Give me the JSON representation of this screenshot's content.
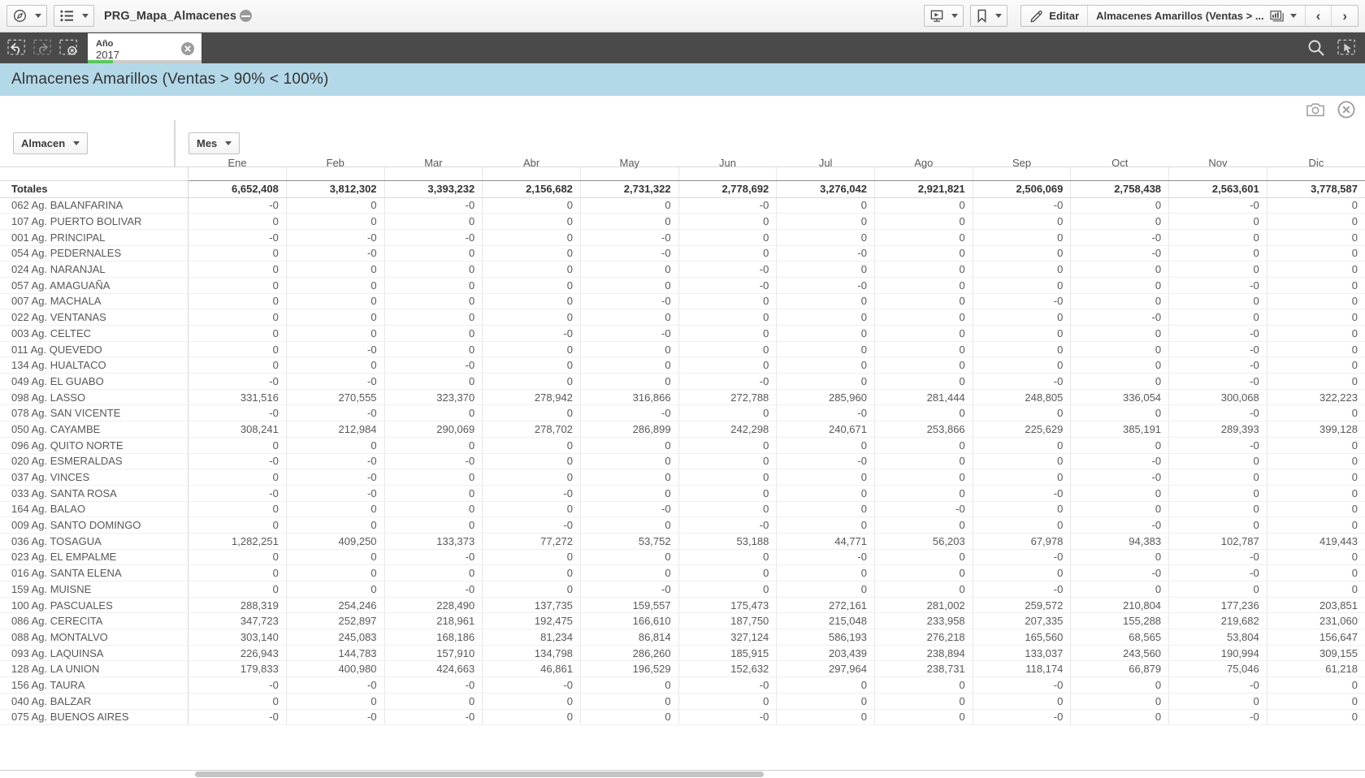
{
  "topbar": {
    "nav_icon": "compass-icon",
    "menu_icon": "list-icon",
    "doc_title": "PRG_Mapa_Almacenes",
    "storytelling_icon": "storytelling-icon",
    "bookmark_icon": "bookmark-icon",
    "edit_icon": "pencil-icon",
    "edit_label": "Editar",
    "sheet_name": "Almacenes Amarillos (Ventas > ...",
    "sheet_icon": "chart-icon",
    "prev_label": "‹",
    "next_label": "›"
  },
  "selection_bar": {
    "back_icon": "selection-back-icon",
    "forward_icon": "selection-forward-icon",
    "clear_icon": "selection-clear-icon",
    "chip": {
      "field": "Año",
      "value": "2017",
      "remove_icon": "remove-selection-icon"
    },
    "search_icon": "search-icon",
    "selections_tool_icon": "selections-tool-icon"
  },
  "sheet": {
    "title": "Almacenes Amarillos (Ventas > 90% < 100%)"
  },
  "object_tools": {
    "snapshot_icon": "camera-icon",
    "close_icon": "close-circle-icon"
  },
  "filters": {
    "almacen": {
      "label": "Almacen",
      "caret": "▼"
    },
    "mes": {
      "label": "Mes",
      "caret": "▼"
    }
  },
  "table": {
    "row_header_label": "",
    "columns": [
      "Ene",
      "Feb",
      "Mar",
      "Abr",
      "May",
      "Jun",
      "Jul",
      "Ago",
      "Sep",
      "Oct",
      "Nov",
      "Dic"
    ],
    "totals_label": "Totales",
    "totals": [
      "6,652,408",
      "3,812,302",
      "3,393,232",
      "2,156,682",
      "2,731,322",
      "2,778,692",
      "3,276,042",
      "2,921,821",
      "2,506,069",
      "2,758,438",
      "2,563,601",
      "3,778,587"
    ],
    "rows": [
      {
        "label": "062 Ag. BALANFARINA",
        "values": [
          "-0",
          "0",
          "-0",
          "0",
          "0",
          "-0",
          "0",
          "0",
          "-0",
          "0",
          "-0",
          "0"
        ]
      },
      {
        "label": "107 Ag. PUERTO BOLIVAR",
        "values": [
          "0",
          "0",
          "0",
          "0",
          "0",
          "0",
          "0",
          "0",
          "0",
          "0",
          "0",
          "0"
        ]
      },
      {
        "label": "001 Ag. PRINCIPAL",
        "values": [
          "-0",
          "-0",
          "-0",
          "0",
          "-0",
          "0",
          "0",
          "0",
          "0",
          "-0",
          "0",
          "0"
        ]
      },
      {
        "label": "054 Ag. PEDERNALES",
        "values": [
          "0",
          "-0",
          "0",
          "0",
          "-0",
          "0",
          "-0",
          "0",
          "0",
          "-0",
          "0",
          "0"
        ]
      },
      {
        "label": "024 Ag. NARANJAL",
        "values": [
          "0",
          "0",
          "0",
          "0",
          "0",
          "-0",
          "0",
          "0",
          "0",
          "0",
          "0",
          "0"
        ]
      },
      {
        "label": "057 Ag. AMAGUAÑA",
        "values": [
          "0",
          "0",
          "0",
          "0",
          "0",
          "-0",
          "-0",
          "0",
          "0",
          "0",
          "-0",
          "0"
        ]
      },
      {
        "label": "007 Ag. MACHALA",
        "values": [
          "0",
          "0",
          "0",
          "0",
          "-0",
          "0",
          "0",
          "0",
          "-0",
          "0",
          "0",
          "0"
        ]
      },
      {
        "label": "022 Ag. VENTANAS",
        "values": [
          "0",
          "0",
          "0",
          "0",
          "0",
          "0",
          "0",
          "0",
          "0",
          "-0",
          "0",
          "0"
        ]
      },
      {
        "label": "003 Ag. CELTEC",
        "values": [
          "0",
          "0",
          "0",
          "-0",
          "-0",
          "0",
          "0",
          "0",
          "0",
          "0",
          "-0",
          "0"
        ]
      },
      {
        "label": "011 Ag. QUEVEDO",
        "values": [
          "0",
          "-0",
          "0",
          "0",
          "0",
          "0",
          "0",
          "0",
          "0",
          "0",
          "-0",
          "0"
        ]
      },
      {
        "label": "134 Ag. HUALTACO",
        "values": [
          "0",
          "0",
          "-0",
          "0",
          "0",
          "0",
          "0",
          "0",
          "0",
          "0",
          "-0",
          "0"
        ]
      },
      {
        "label": "049 Ag. EL GUABO",
        "values": [
          "-0",
          "-0",
          "0",
          "0",
          "0",
          "-0",
          "0",
          "0",
          "-0",
          "0",
          "-0",
          "0"
        ]
      },
      {
        "label": "098 Ag. LASSO",
        "values": [
          "331,516",
          "270,555",
          "323,370",
          "278,942",
          "316,866",
          "272,788",
          "285,960",
          "281,444",
          "248,805",
          "336,054",
          "300,068",
          "322,223"
        ]
      },
      {
        "label": "078 Ag. SAN VICENTE",
        "values": [
          "-0",
          "-0",
          "0",
          "0",
          "-0",
          "0",
          "-0",
          "0",
          "0",
          "0",
          "-0",
          "0"
        ]
      },
      {
        "label": "050 Ag. CAYAMBE",
        "values": [
          "308,241",
          "212,984",
          "290,069",
          "278,702",
          "286,899",
          "242,298",
          "240,671",
          "253,866",
          "225,629",
          "385,191",
          "289,393",
          "399,128"
        ]
      },
      {
        "label": "096 Ag. QUITO NORTE",
        "values": [
          "0",
          "0",
          "0",
          "0",
          "0",
          "0",
          "0",
          "0",
          "0",
          "0",
          "-0",
          "0"
        ]
      },
      {
        "label": "020 Ag. ESMERALDAS",
        "values": [
          "-0",
          "-0",
          "-0",
          "0",
          "0",
          "0",
          "-0",
          "0",
          "0",
          "-0",
          "0",
          "0"
        ]
      },
      {
        "label": "037 Ag. VINCES",
        "values": [
          "0",
          "-0",
          "0",
          "0",
          "0",
          "0",
          "0",
          "0",
          "0",
          "-0",
          "0",
          "0"
        ]
      },
      {
        "label": "033 Ag. SANTA ROSA",
        "values": [
          "-0",
          "-0",
          "0",
          "-0",
          "0",
          "0",
          "0",
          "0",
          "-0",
          "0",
          "0",
          "0"
        ]
      },
      {
        "label": "164 Ag. BALAO",
        "values": [
          "0",
          "0",
          "0",
          "0",
          "-0",
          "0",
          "0",
          "-0",
          "0",
          "0",
          "0",
          "0"
        ]
      },
      {
        "label": "009 Ag. SANTO DOMINGO",
        "values": [
          "0",
          "0",
          "0",
          "-0",
          "0",
          "-0",
          "0",
          "0",
          "0",
          "-0",
          "0",
          "0"
        ]
      },
      {
        "label": "036 Ag. TOSAGUA",
        "values": [
          "1,282,251",
          "409,250",
          "133,373",
          "77,272",
          "53,752",
          "53,188",
          "44,771",
          "56,203",
          "67,978",
          "94,383",
          "102,787",
          "419,443"
        ]
      },
      {
        "label": "023 Ag. EL EMPALME",
        "values": [
          "0",
          "0",
          "-0",
          "0",
          "0",
          "0",
          "-0",
          "0",
          "-0",
          "0",
          "-0",
          "0"
        ]
      },
      {
        "label": "016 Ag. SANTA ELENA",
        "values": [
          "0",
          "0",
          "0",
          "0",
          "0",
          "0",
          "0",
          "0",
          "0",
          "-0",
          "-0",
          "0"
        ]
      },
      {
        "label": "159 Ag. MUISNE",
        "values": [
          "0",
          "0",
          "-0",
          "0",
          "-0",
          "0",
          "0",
          "0",
          "-0",
          "0",
          "0",
          "0"
        ]
      },
      {
        "label": "100 Ag. PASCUALES",
        "values": [
          "288,319",
          "254,246",
          "228,490",
          "137,735",
          "159,557",
          "175,473",
          "272,161",
          "281,002",
          "259,572",
          "210,804",
          "177,236",
          "203,851"
        ]
      },
      {
        "label": "086 Ag. CERECITA",
        "values": [
          "347,723",
          "252,897",
          "218,961",
          "192,475",
          "166,610",
          "187,750",
          "215,048",
          "233,958",
          "207,335",
          "155,288",
          "219,682",
          "231,060"
        ]
      },
      {
        "label": "088 Ag. MONTALVO",
        "values": [
          "303,140",
          "245,083",
          "168,186",
          "81,234",
          "86,814",
          "327,124",
          "586,193",
          "276,218",
          "165,560",
          "68,565",
          "53,804",
          "156,647"
        ]
      },
      {
        "label": "093 Ag. LAQUINSA",
        "values": [
          "226,943",
          "144,783",
          "157,910",
          "134,798",
          "286,260",
          "185,915",
          "203,439",
          "238,894",
          "133,037",
          "243,560",
          "190,994",
          "309,155"
        ]
      },
      {
        "label": "128 Ag. LA UNION",
        "values": [
          "179,833",
          "400,980",
          "424,663",
          "46,861",
          "196,529",
          "152,632",
          "297,964",
          "238,731",
          "118,174",
          "66,879",
          "75,046",
          "61,218"
        ]
      },
      {
        "label": "156 Ag. TAURA",
        "values": [
          "-0",
          "-0",
          "-0",
          "-0",
          "0",
          "-0",
          "0",
          "0",
          "-0",
          "0",
          "-0",
          "0"
        ]
      },
      {
        "label": "040 Ag. BALZAR",
        "values": [
          "0",
          "0",
          "0",
          "0",
          "0",
          "0",
          "0",
          "0",
          "0",
          "0",
          "0",
          "0"
        ]
      },
      {
        "label": "075 Ag. BUENOS AIRES",
        "values": [
          "-0",
          "-0",
          "-0",
          "0",
          "0",
          "-0",
          "0",
          "0",
          "-0",
          "0",
          "-0",
          "0"
        ]
      }
    ]
  },
  "colors": {
    "sheet_title_bg": "#b3d8e8",
    "selection_bar_bg": "#4a4a4a",
    "selection_state_green": "#5ac85a"
  }
}
